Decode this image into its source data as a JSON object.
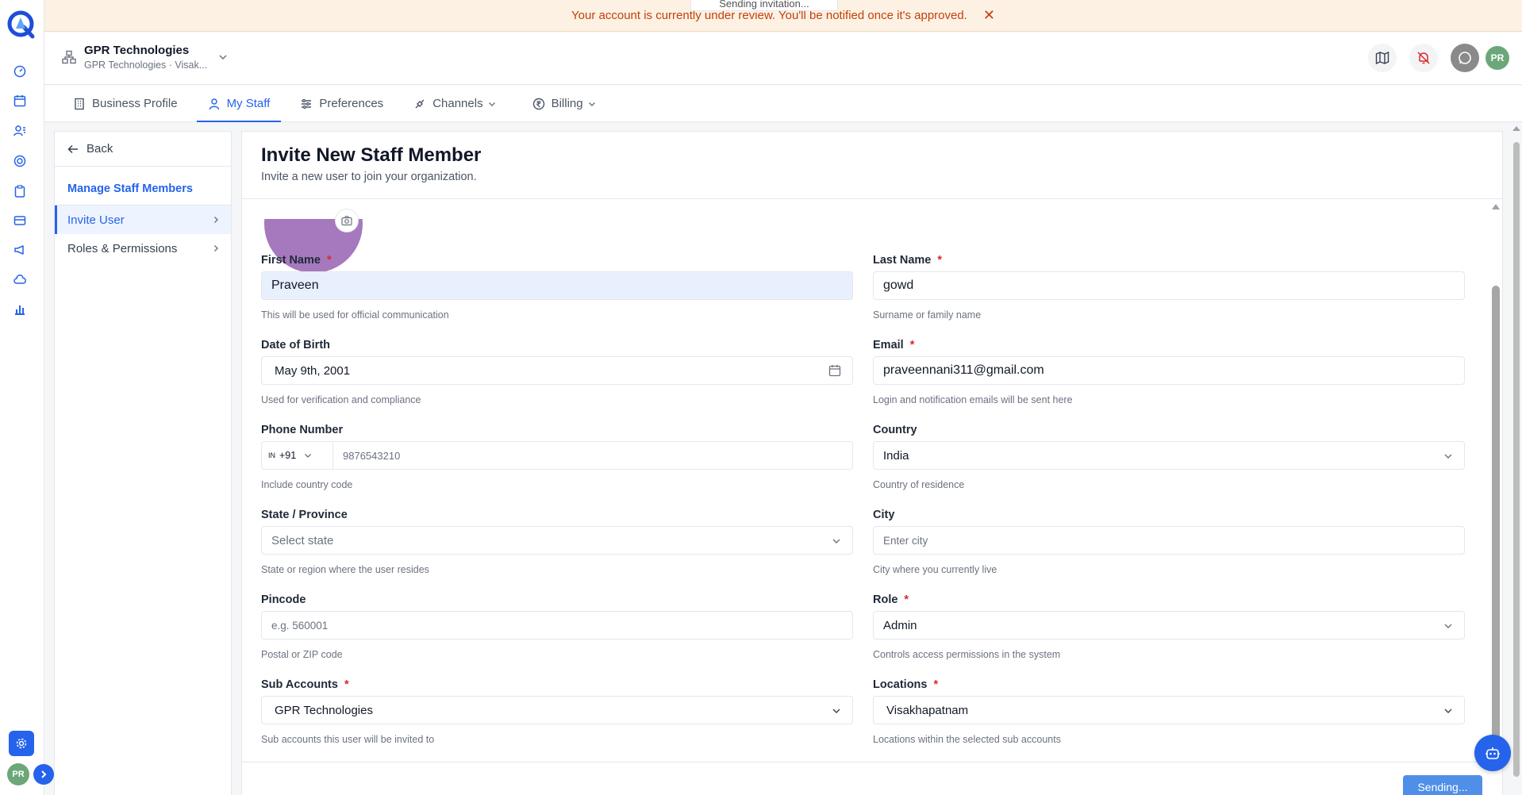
{
  "banner": {
    "message": "Your account is currently under review. You'll be notified once it's approved.",
    "close": "✕"
  },
  "toast": {
    "message": "Sending invitation..."
  },
  "header": {
    "org_name": "GPR Technologies",
    "org_sub": "GPR Technologies · Visak...",
    "avatar_initials": "PR"
  },
  "rail": {
    "avatar_initials": "PR"
  },
  "tabs": [
    {
      "label": "Business Profile",
      "active": false
    },
    {
      "label": "My Staff",
      "active": true
    },
    {
      "label": "Preferences",
      "active": false
    },
    {
      "label": "Channels",
      "active": false
    },
    {
      "label": "Billing",
      "active": false
    }
  ],
  "side": {
    "back_label": "Back",
    "section_title": "Manage Staff Members",
    "items": [
      {
        "label": "Invite User",
        "active": true
      },
      {
        "label": "Roles & Permissions",
        "active": false
      }
    ]
  },
  "form": {
    "title": "Invite New Staff Member",
    "subtitle": "Invite a new user to join your organization.",
    "first_name": {
      "label": "First Name",
      "value": "Praveen",
      "help": "This will be used for official communication"
    },
    "last_name": {
      "label": "Last Name",
      "value": "gowd",
      "help": "Surname or family name"
    },
    "dob": {
      "label": "Date of Birth",
      "value": "May 9th, 2001",
      "help": "Used for verification and compliance"
    },
    "email": {
      "label": "Email",
      "value": "praveennani311@gmail.com",
      "help": "Login and notification emails will be sent here"
    },
    "phone": {
      "label": "Phone Number",
      "country_flag": "IN",
      "country_code": "+91",
      "placeholder": "9876543210",
      "help": "Include country code"
    },
    "country": {
      "label": "Country",
      "value": "India",
      "help": "Country of residence"
    },
    "state": {
      "label": "State / Province",
      "placeholder": "Select state",
      "help": "State or region where the user resides"
    },
    "city": {
      "label": "City",
      "placeholder": "Enter city",
      "help": "City where you currently live"
    },
    "pincode": {
      "label": "Pincode",
      "placeholder": "e.g. 560001",
      "help": "Postal or ZIP code"
    },
    "role": {
      "label": "Role",
      "value": "Admin",
      "help": "Controls access permissions in the system"
    },
    "sub_accounts": {
      "label": "Sub Accounts",
      "value": "GPR Technologies",
      "help": "Sub accounts this user will be invited to"
    },
    "locations": {
      "label": "Locations",
      "value": "Visakhapatnam",
      "help": "Locations within the selected sub accounts"
    },
    "required_mark": "*",
    "submit_label": "Sending..."
  },
  "colors": {
    "accent": "#2563eb",
    "banner_bg": "#fdf1e3",
    "banner_text": "#c2410c",
    "required": "#dc2626",
    "avatar": "#a678bd"
  }
}
